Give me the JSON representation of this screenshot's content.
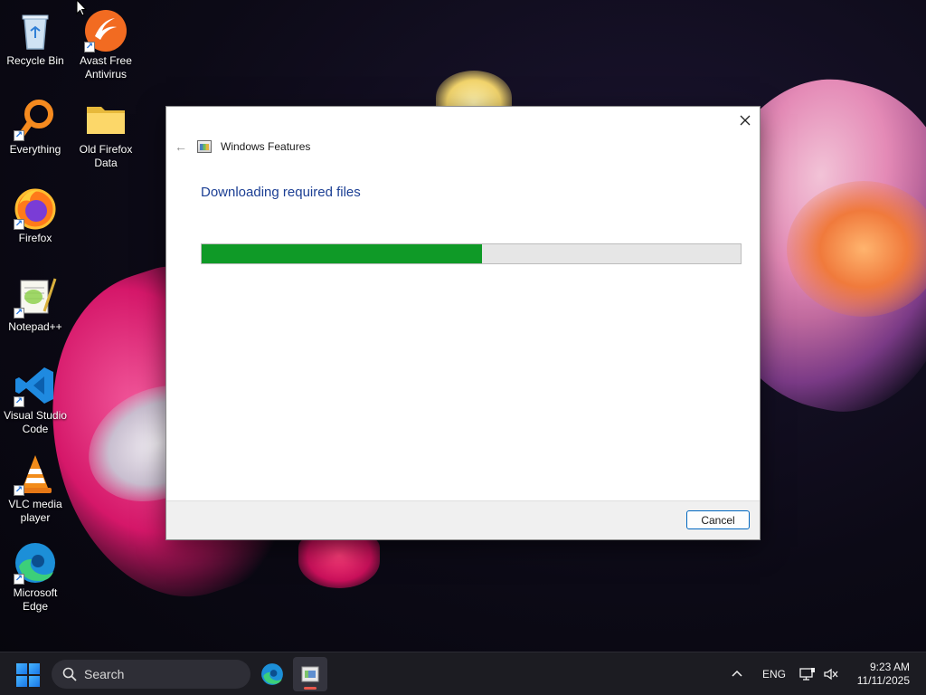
{
  "desktop": {
    "icons": [
      {
        "label": "Recycle Bin"
      },
      {
        "label": "Avast Free Antivirus"
      },
      {
        "label": "Everything"
      },
      {
        "label": "Old Firefox Data"
      },
      {
        "label": "Firefox"
      },
      {
        "label": "Notepad++"
      },
      {
        "label": "Visual Studio Code"
      },
      {
        "label": "VLC media player"
      },
      {
        "label": "Microsoft Edge"
      }
    ]
  },
  "dialog": {
    "title": "Windows Features",
    "heading": "Downloading required files",
    "progress_fraction": 0.52,
    "cancel_label": "Cancel",
    "icons": {
      "close": "close-icon",
      "back": "back-arrow-icon",
      "app": "windows-features-icon"
    }
  },
  "taskbar": {
    "search_placeholder": "Search",
    "language": "ENG",
    "time": "9:23 AM",
    "date": "11/11/2025",
    "apps": [
      "microsoft-edge-icon",
      "windows-features-icon"
    ]
  },
  "colors": {
    "progress_fill": "#0f9a27",
    "heading": "#1c3f94",
    "taskbar_bg": "#1c1c22",
    "accent": "#0067c0"
  }
}
